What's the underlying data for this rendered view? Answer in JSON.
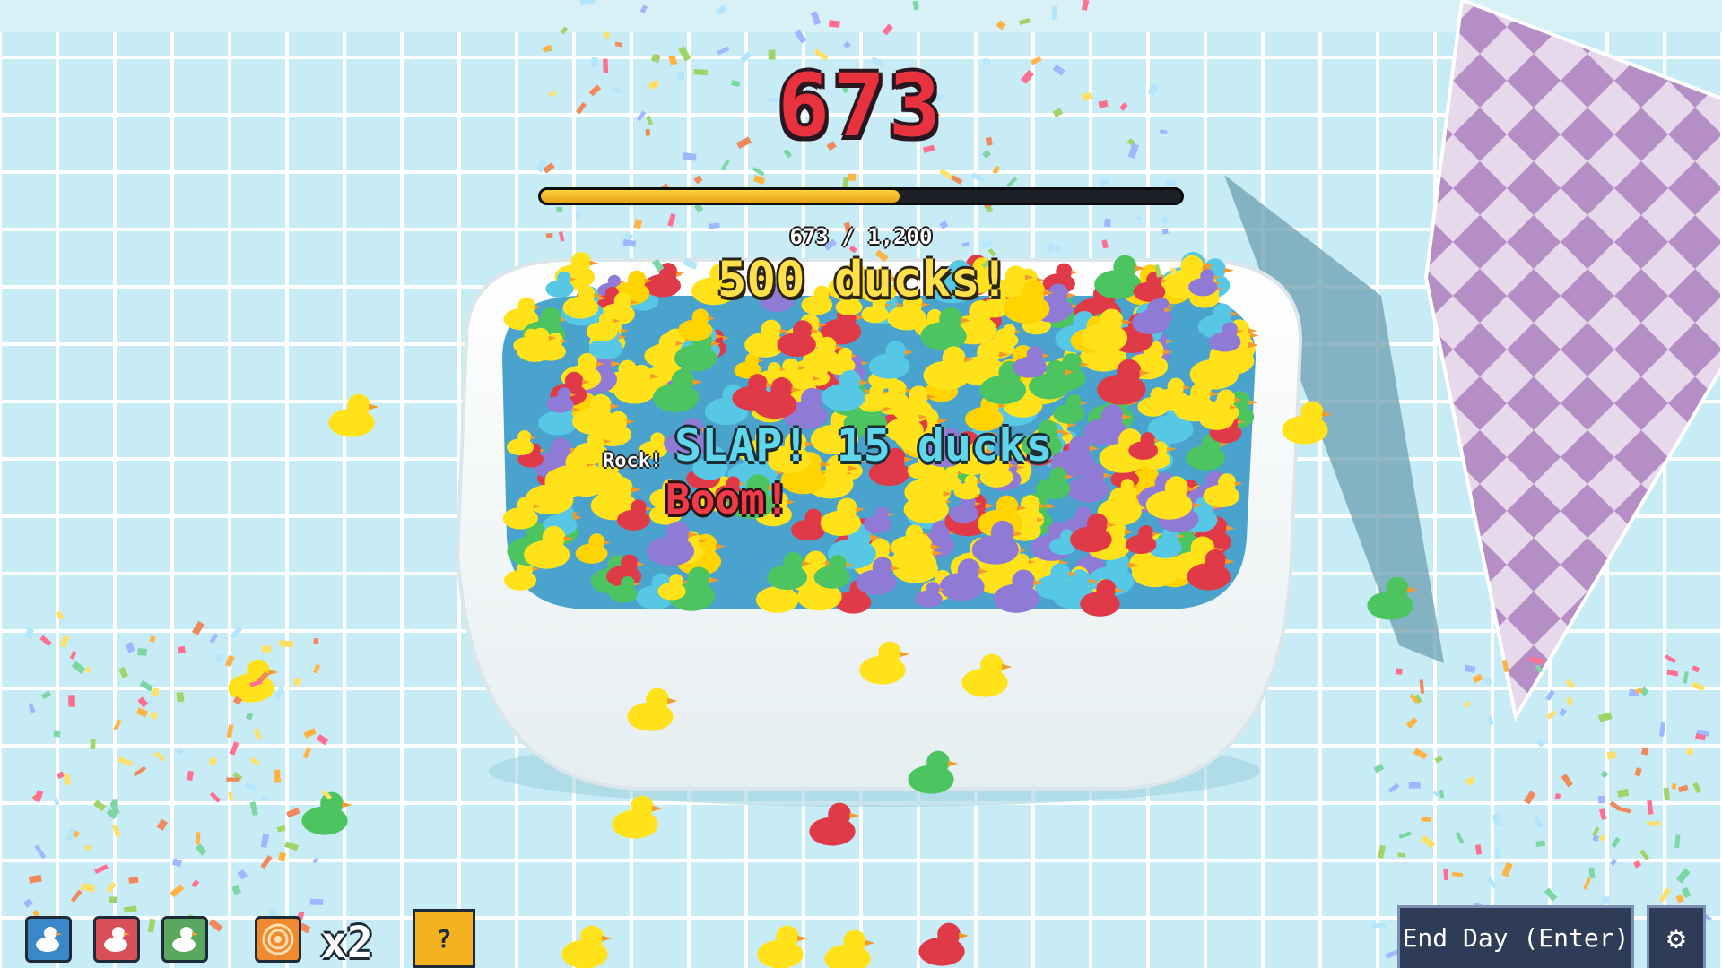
{
  "hud": {
    "score": "673",
    "progress_current": 673,
    "progress_target": 1200,
    "progress_text": "673 / 1,200"
  },
  "floating_messages": {
    "milestone": "500 ducks!",
    "slap": "SLAP! 15 ducks",
    "boom": "Boom!",
    "rock": "Rock!"
  },
  "inventory": {
    "slots": [
      {
        "icon": "white-duck-icon",
        "color": "#3a88c8"
      },
      {
        "icon": "red-duck-icon",
        "color": "#d9505b"
      },
      {
        "icon": "green-duck-icon",
        "color": "#5aa860"
      },
      {
        "icon": "target-icon",
        "color": "#f08a2e"
      }
    ],
    "multiplier": "x2",
    "mystery_label": "?"
  },
  "buttons": {
    "end_day": "End Day (Enter)",
    "settings_icon": "gear-icon"
  },
  "colors": {
    "score": "#e8333f",
    "progress_fill": "#f2b91f",
    "floor_tile": "#cdeff7",
    "grout": "#ffffff"
  }
}
